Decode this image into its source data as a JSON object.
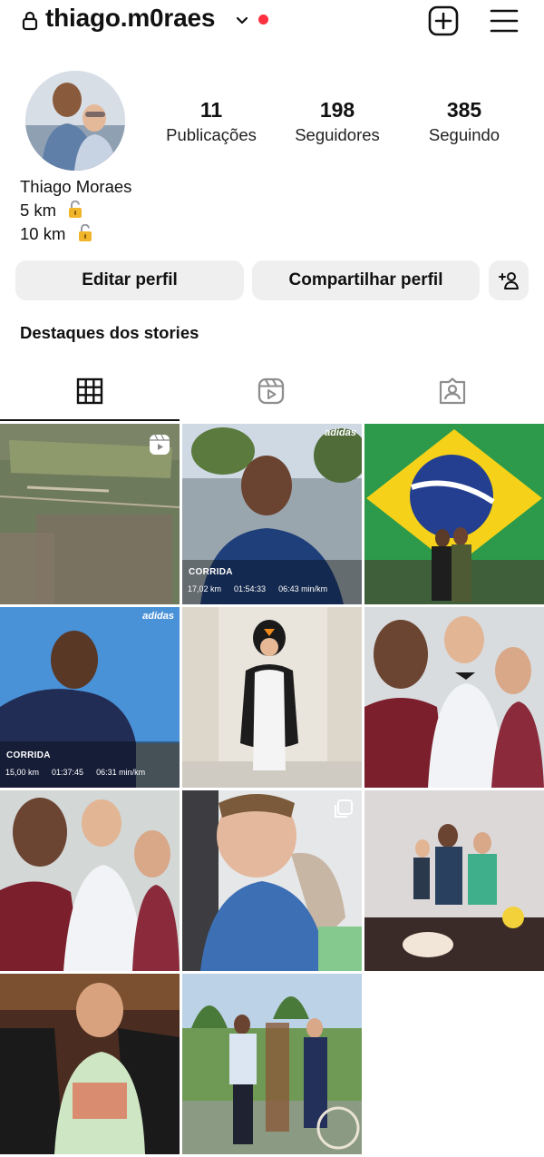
{
  "header": {
    "username": "thiago.m0raes",
    "colors": {
      "notification_dot": "#ff3040"
    },
    "icons": [
      "lock-icon",
      "chevron-down-icon",
      "new-post-icon",
      "menu-icon"
    ]
  },
  "profile": {
    "stats": [
      {
        "value": "11",
        "label": "Publicações"
      },
      {
        "value": "198",
        "label": "Seguidores"
      },
      {
        "value": "385",
        "label": "Seguindo"
      }
    ],
    "name": "Thiago Moraes",
    "bio_lines": [
      "5 km",
      "10 km"
    ],
    "bio_icon": "unlocked-lock-icon"
  },
  "actions": {
    "edit_label": "Editar perfil",
    "share_label": "Compartilhar perfil",
    "add_icon": "add-user-icon"
  },
  "highlights": {
    "title": "Destaques dos stories"
  },
  "tabs": [
    {
      "icon": "grid-icon",
      "selected": true
    },
    {
      "icon": "reels-icon",
      "selected": false
    },
    {
      "icon": "tagged-icon",
      "selected": false
    }
  ],
  "posts": [
    {
      "type": "reel",
      "subject": "aerial map"
    },
    {
      "subject": "running selfie",
      "brand": "adidas",
      "label": "CORRIDA",
      "stats": [
        "17,02 km",
        "01:54:33",
        "06:43 min/km"
      ]
    },
    {
      "subject": "family with Brazil flag"
    },
    {
      "subject": "running selfie",
      "brand": "adidas",
      "label": "CORRIDA",
      "stats": [
        "15,00 km",
        "01:37:45",
        "06:31 min/km"
      ]
    },
    {
      "subject": "child in penguin costume"
    },
    {
      "subject": "family selfie"
    },
    {
      "subject": "family selfie"
    },
    {
      "type": "carousel",
      "subject": "baby portrait"
    },
    {
      "subject": "family at celebration"
    },
    {
      "subject": "child in barber chair"
    },
    {
      "subject": "family with LOVE sign"
    }
  ]
}
